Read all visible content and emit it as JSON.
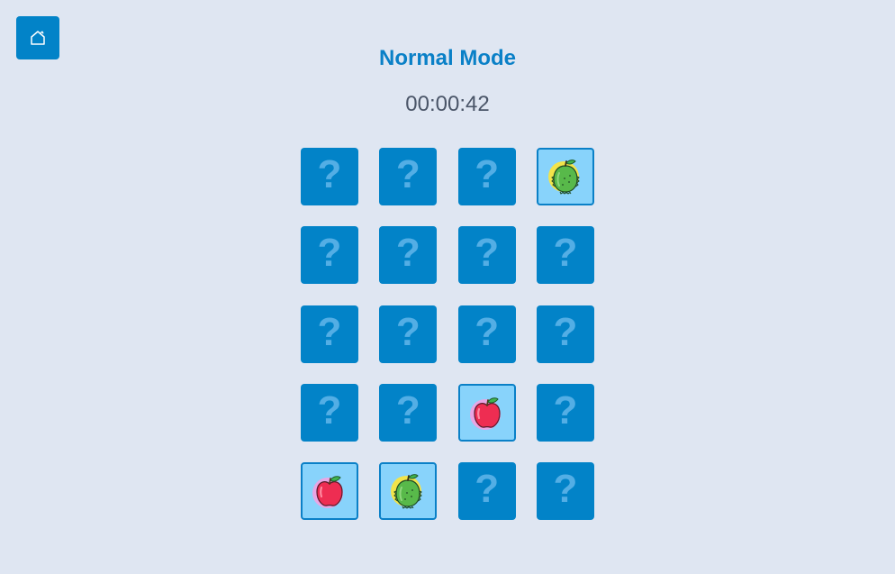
{
  "header": {
    "home_icon": "home-icon",
    "title": "Normal Mode",
    "timer": "00:00:42"
  },
  "colors": {
    "background": "#dfe6f2",
    "card_hidden": "#0283c8",
    "card_revealed": "#88d3fb",
    "accent": "#0a80c7",
    "question_mark": "#53aee5"
  },
  "board": {
    "rows": 5,
    "columns": 4,
    "hidden_glyph": "?",
    "cards": [
      {
        "state": "hidden",
        "fruit": null
      },
      {
        "state": "hidden",
        "fruit": null
      },
      {
        "state": "hidden",
        "fruit": null
      },
      {
        "state": "revealed",
        "fruit": "durian"
      },
      {
        "state": "hidden",
        "fruit": null
      },
      {
        "state": "hidden",
        "fruit": null
      },
      {
        "state": "hidden",
        "fruit": null
      },
      {
        "state": "hidden",
        "fruit": null
      },
      {
        "state": "hidden",
        "fruit": null
      },
      {
        "state": "hidden",
        "fruit": null
      },
      {
        "state": "hidden",
        "fruit": null
      },
      {
        "state": "hidden",
        "fruit": null
      },
      {
        "state": "hidden",
        "fruit": null
      },
      {
        "state": "hidden",
        "fruit": null
      },
      {
        "state": "revealed",
        "fruit": "apple"
      },
      {
        "state": "hidden",
        "fruit": null
      },
      {
        "state": "revealed",
        "fruit": "apple"
      },
      {
        "state": "revealed",
        "fruit": "durian"
      },
      {
        "state": "hidden",
        "fruit": null
      },
      {
        "state": "hidden",
        "fruit": null
      }
    ]
  }
}
